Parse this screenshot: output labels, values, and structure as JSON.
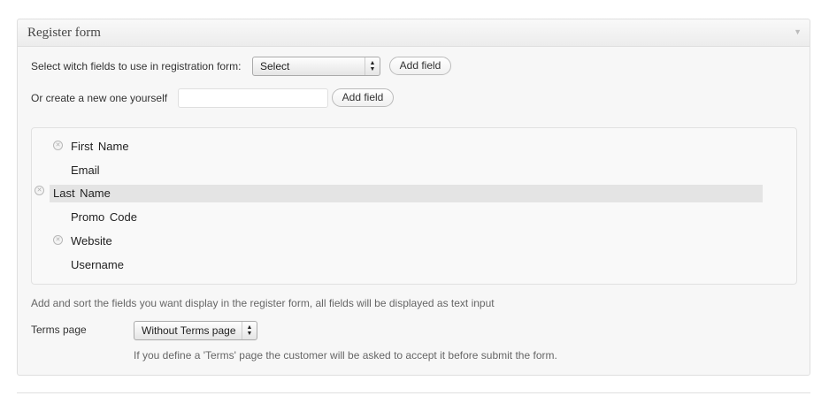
{
  "panel": {
    "title": "Register form",
    "toggle_icon": "▼"
  },
  "select_row": {
    "label": "Select witch fields to use in registration form:",
    "select_value": "Select",
    "add_button": "Add field"
  },
  "create_row": {
    "label": "Or create a new one yourself",
    "input_value": "",
    "add_button": "Add field"
  },
  "fields": [
    {
      "label": "First  Name",
      "removable": true
    },
    {
      "label": "Email",
      "removable": false
    },
    {
      "label": "Last  Name",
      "removable": true,
      "dragging": true
    },
    {
      "label": "Promo  Code",
      "removable": false
    },
    {
      "label": "Website",
      "removable": true
    },
    {
      "label": "Username",
      "removable": false
    }
  ],
  "fields_hint": "Add and sort the fields you want display in the register form, all fields will be displayed as text input",
  "terms": {
    "label": "Terms page",
    "select_value": "Without Terms page",
    "hint": "If you define a 'Terms' page the customer will be asked to accept it before submit the form."
  }
}
